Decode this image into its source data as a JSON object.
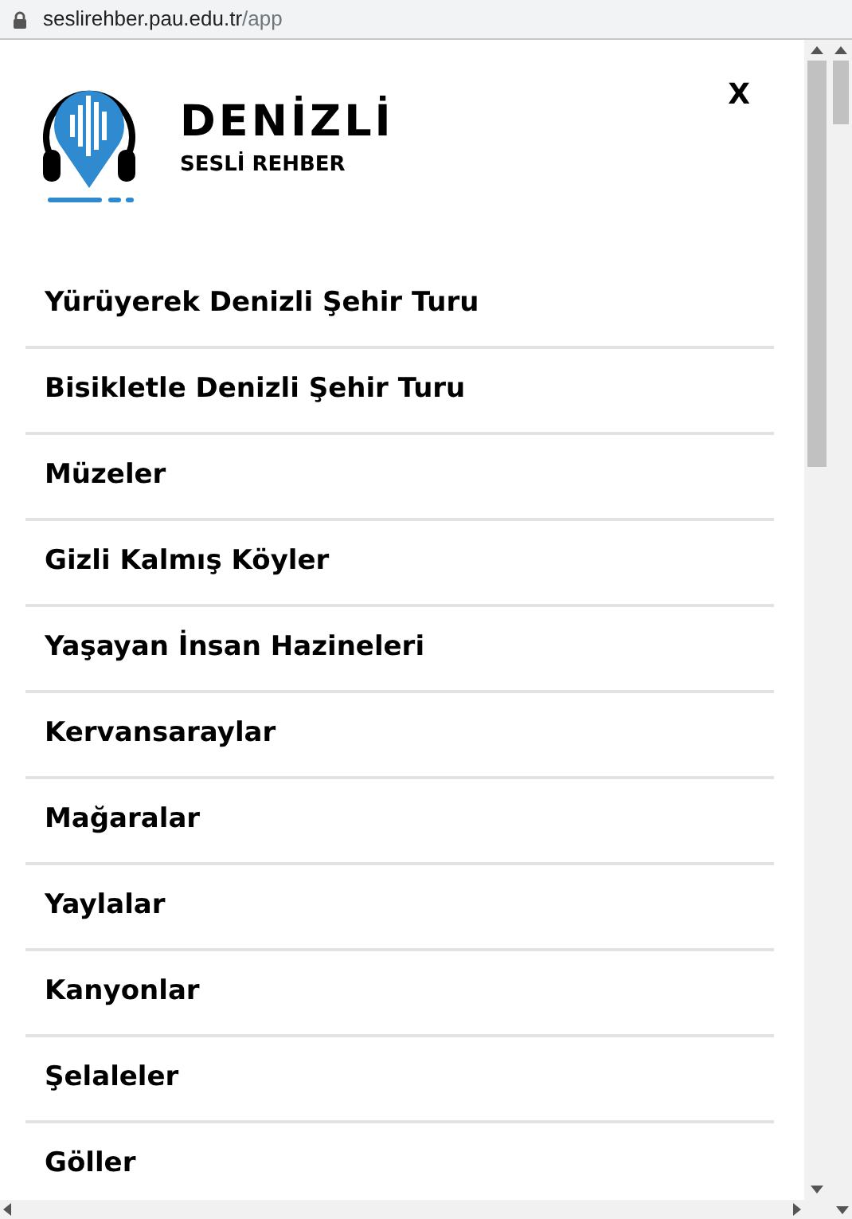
{
  "address_bar": {
    "host": "seslirehber.pau.edu.tr",
    "path": "/app"
  },
  "header": {
    "title": "DENİZLİ",
    "subtitle": "SESLİ REHBER",
    "close": "X"
  },
  "menu": [
    {
      "label": "Yürüyerek Denizli Şehir Turu"
    },
    {
      "label": "Bisikletle Denizli Şehir Turu"
    },
    {
      "label": "Müzeler"
    },
    {
      "label": "Gizli Kalmış Köyler"
    },
    {
      "label": "Yaşayan İnsan Hazineleri"
    },
    {
      "label": "Kervansaraylar"
    },
    {
      "label": "Mağaralar"
    },
    {
      "label": "Yaylalar"
    },
    {
      "label": "Kanyonlar"
    },
    {
      "label": "Şelaleler"
    },
    {
      "label": "Göller"
    }
  ]
}
